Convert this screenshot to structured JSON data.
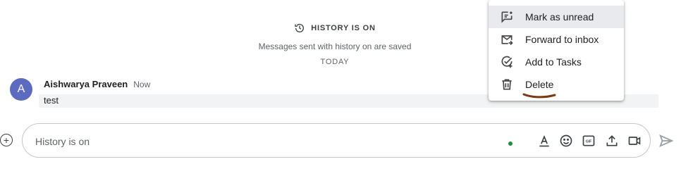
{
  "history": {
    "title": "HISTORY IS ON",
    "subtitle": "Messages sent with history on are saved",
    "icon": "history-clock-icon"
  },
  "divider": {
    "label": "TODAY"
  },
  "message": {
    "avatar_letter": "A",
    "sender": "Aishwarya Praveen",
    "time": "Now",
    "text": "test",
    "avatar_color": "#5c6bc0"
  },
  "composer": {
    "placeholder": "History is on",
    "status_dot_color": "#1e8e3e",
    "tools": [
      "format-text-icon",
      "emoji-icon",
      "gif-icon",
      "upload-icon",
      "video-call-icon"
    ]
  },
  "context_menu": {
    "items": [
      {
        "label": "Mark as unread",
        "icon": "mark-unread-icon"
      },
      {
        "label": "Forward to inbox",
        "icon": "forward-inbox-icon"
      },
      {
        "label": "Add to Tasks",
        "icon": "add-task-icon"
      },
      {
        "label": "Delete",
        "icon": "trash-icon"
      }
    ],
    "highlighted_item": "Mark as unread",
    "annotation_color": "#7a3b12"
  }
}
